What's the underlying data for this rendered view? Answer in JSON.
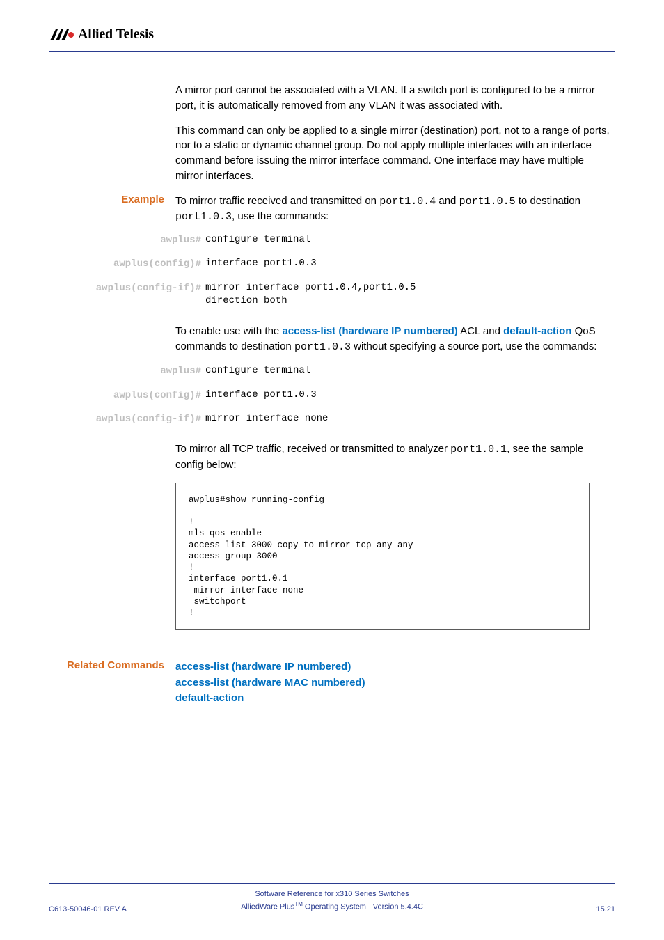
{
  "logo_text": "Allied Telesis",
  "para1": "A mirror port cannot be associated with a VLAN. If a switch port is configured to be a mirror port, it is automatically removed from any VLAN it was associated with.",
  "para2": "This command can only be applied to a single mirror (destination) port, not to a range of ports, nor to a static or dynamic channel group. Do not apply multiple interfaces with an interface command before issuing the mirror interface command. One interface may have multiple mirror interfaces.",
  "example_label": "Example",
  "example_text_pre": "To mirror traffic received and transmitted on ",
  "example_port_a": "port1.0.4",
  "example_text_mid1": " and ",
  "example_port_b": "port1.0.5",
  "example_text_mid2": " to destination ",
  "example_port_c": "port1.0.3",
  "example_text_post": ", use the commands:",
  "cmds1": [
    {
      "prompt": "awplus#",
      "cmd": "configure terminal"
    },
    {
      "prompt": "awplus(config)#",
      "cmd": "interface port1.0.3"
    },
    {
      "prompt": "awplus(config-if)#",
      "cmd": "mirror interface port1.0.4,port1.0.5 \ndirection both"
    }
  ],
  "enable_pre": "To enable use with the ",
  "enable_link1": "access-list (hardware IP numbered)",
  "enable_mid1": " ACL and ",
  "enable_link2": "default-action",
  "enable_mid2": " QoS commands to destination ",
  "enable_port": "port1.0.3",
  "enable_post": " without specifying a source port, use the commands:",
  "cmds2": [
    {
      "prompt": "awplus#",
      "cmd": "configure terminal"
    },
    {
      "prompt": "awplus(config)#",
      "cmd": "interface port1.0.3"
    },
    {
      "prompt": "awplus(config-if)#",
      "cmd": "mirror interface none"
    }
  ],
  "mirror_pre": "To mirror all TCP traffic, received or transmitted to analyzer ",
  "mirror_port": "port1.0.1",
  "mirror_post": ", see the sample config below:",
  "config_box": "awplus#show running-config\n\n!\nmls qos enable\naccess-list 3000 copy-to-mirror tcp any any\naccess-group 3000\n!\ninterface port1.0.1\n mirror interface none\n switchport\n!",
  "related_label": "Related Commands",
  "related_links": [
    "access-list (hardware IP numbered)",
    "access-list (hardware MAC numbered)",
    "default-action"
  ],
  "footer_left": "C613-50046-01 REV A",
  "footer_center_1": "Software Reference for x310 Series Switches",
  "footer_center_2a": "AlliedWare Plus",
  "footer_center_2b": "TM",
  "footer_center_2c": " Operating System - Version 5.4.4C",
  "footer_right": "15.21"
}
